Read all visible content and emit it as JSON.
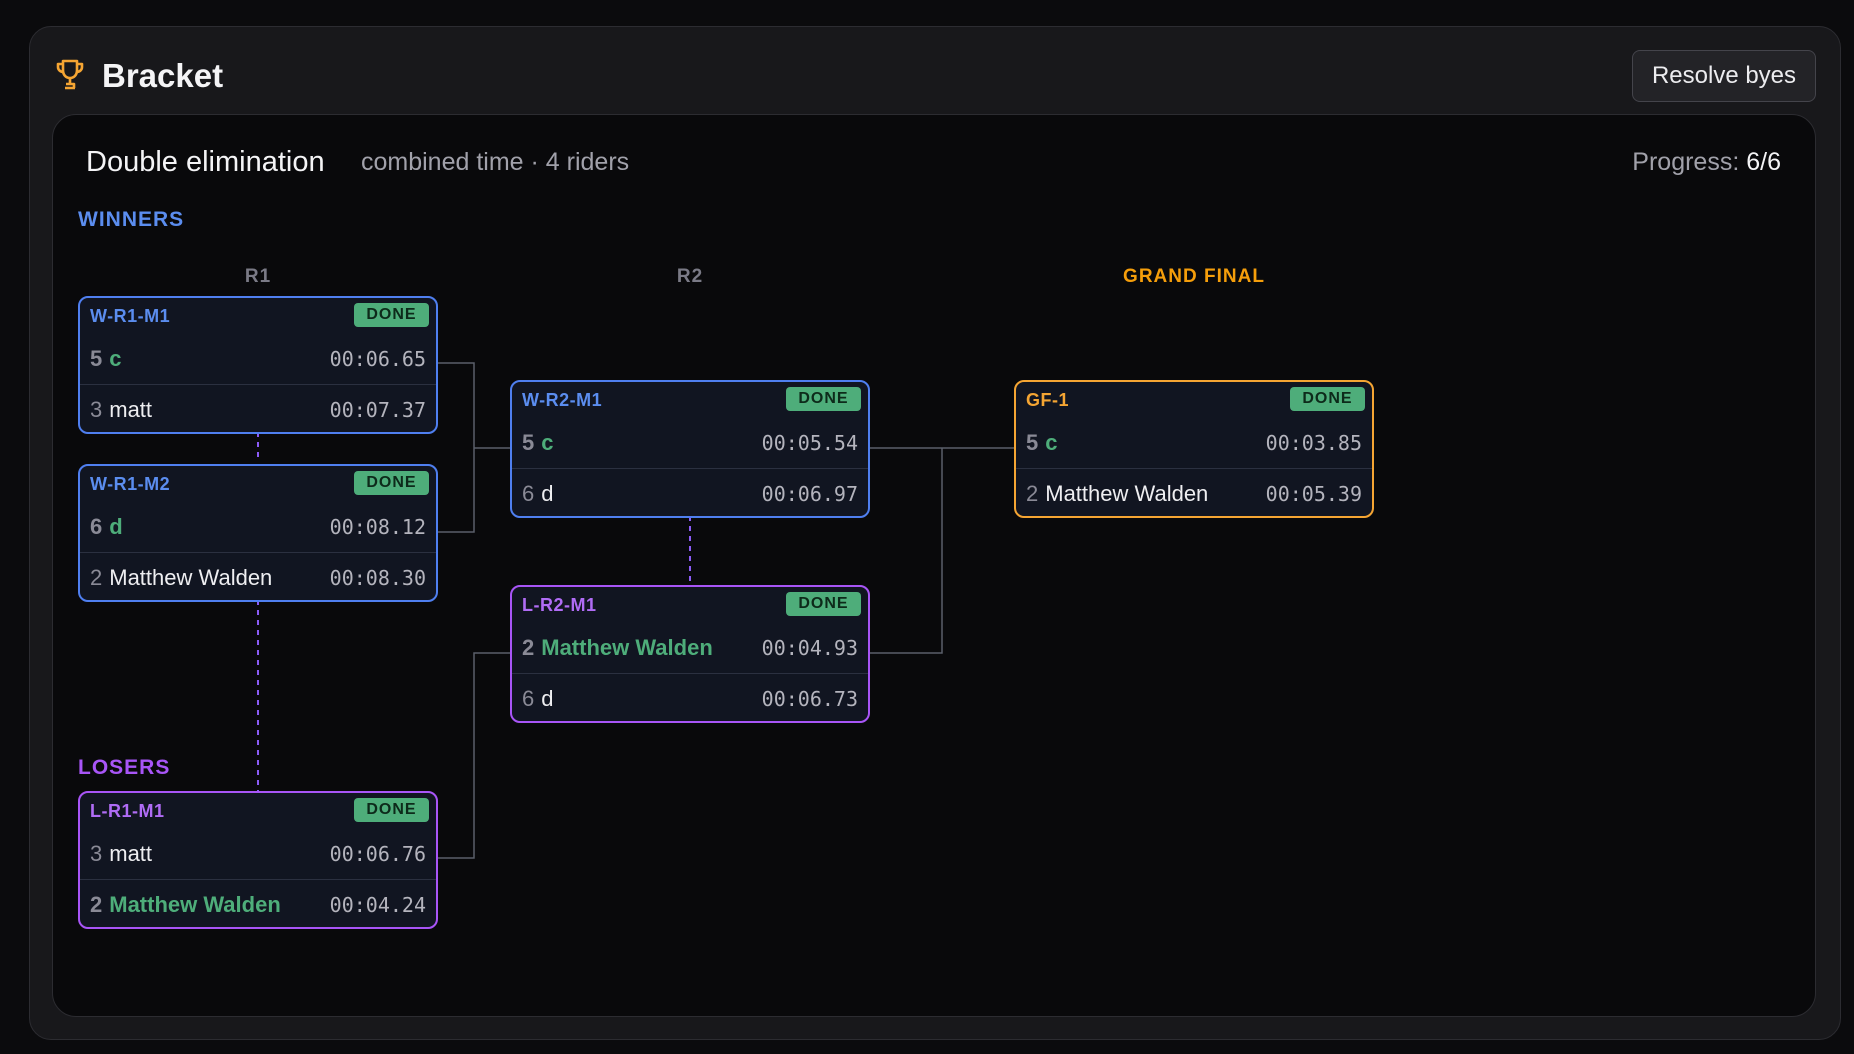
{
  "header": {
    "title": "Bracket",
    "icon": "trophy-icon",
    "resolve_button": "Resolve byes"
  },
  "bracket": {
    "title": "Double elimination",
    "subtitle": "combined time · 4 riders",
    "progress_label": "Progress:",
    "progress_value": "6/6",
    "winners_label": "WINNERS",
    "losers_label": "LOSERS",
    "round_labels": {
      "r1": "R1",
      "r2": "R2",
      "gf": "GRAND FINAL"
    }
  },
  "matches": {
    "wr1m1": {
      "id": "W-R1-M1",
      "status": "DONE",
      "p1": {
        "seed": "5",
        "name": "c",
        "time": "00:06.65"
      },
      "p2": {
        "seed": "3",
        "name": "matt",
        "time": "00:07.37"
      }
    },
    "wr1m2": {
      "id": "W-R1-M2",
      "status": "DONE",
      "p1": {
        "seed": "6",
        "name": "d",
        "time": "00:08.12"
      },
      "p2": {
        "seed": "2",
        "name": "Matthew Walden",
        "time": "00:08.30"
      }
    },
    "wr2m1": {
      "id": "W-R2-M1",
      "status": "DONE",
      "p1": {
        "seed": "5",
        "name": "c",
        "time": "00:05.54"
      },
      "p2": {
        "seed": "6",
        "name": "d",
        "time": "00:06.97"
      }
    },
    "lr2m1": {
      "id": "L-R2-M1",
      "status": "DONE",
      "p1": {
        "seed": "2",
        "name": "Matthew Walden",
        "time": "00:04.93"
      },
      "p2": {
        "seed": "6",
        "name": "d",
        "time": "00:06.73"
      }
    },
    "lr1m1": {
      "id": "L-R1-M1",
      "status": "DONE",
      "p1": {
        "seed": "3",
        "name": "matt",
        "time": "00:06.76"
      },
      "p2": {
        "seed": "2",
        "name": "Matthew Walden",
        "time": "00:04.24"
      }
    },
    "gf1": {
      "id": "GF-1",
      "status": "DONE",
      "p1": {
        "seed": "5",
        "name": "c",
        "time": "00:03.85"
      },
      "p2": {
        "seed": "2",
        "name": "Matthew Walden",
        "time": "00:05.39"
      }
    }
  },
  "colors": {
    "winners": "#4f7ff0",
    "losers": "#a855f7",
    "grand_final": "#f5a533",
    "done_badge": "#4ead7a",
    "winner_name": "#4ead7a"
  }
}
